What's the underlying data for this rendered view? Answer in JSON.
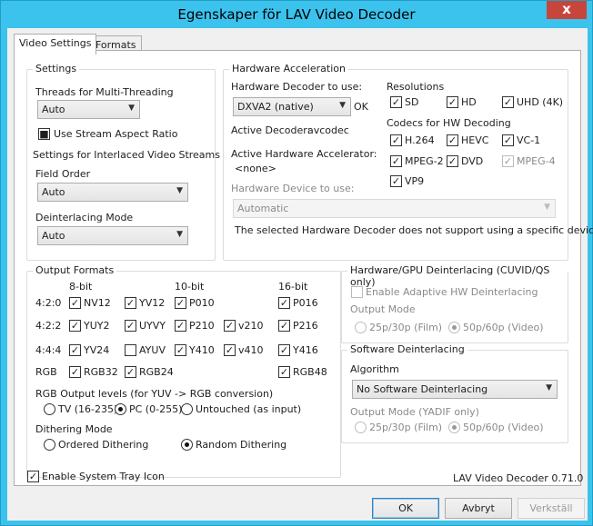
{
  "window": {
    "title": "Egenskaper för LAV Video Decoder",
    "close_glyph": "x"
  },
  "tabs": [
    {
      "label": "Video Settings"
    },
    {
      "label": "Formats"
    }
  ],
  "settings": {
    "title": "Settings",
    "threads_label": "Threads for Multi-Threading",
    "threads_value": "Auto",
    "stream_ar_label": "Use Stream Aspect Ratio",
    "stream_ar_checked": true,
    "interlaced_label": "Settings for Interlaced Video Streams",
    "field_order_label": "Field Order",
    "field_order_value": "Auto",
    "deint_mode_label": "Deinterlacing Mode",
    "deint_mode_value": "Auto"
  },
  "hwaccel": {
    "title": "Hardware Acceleration",
    "decoder_label": "Hardware Decoder to use:",
    "decoder_value": "DXVA2 (native)",
    "decoder_status": "OK",
    "active_decoder_label": "Active Decoder:",
    "active_decoder_value": "avcodec",
    "active_accel_label": "Active Hardware Accelerator:",
    "active_accel_value": "<none>",
    "device_label": "Hardware Device to use:",
    "device_value": "Automatic",
    "note": "The selected Hardware Decoder does not support using a specific device.",
    "resolutions_label": "Resolutions",
    "resolutions": [
      {
        "label": "SD",
        "checked": true
      },
      {
        "label": "HD",
        "checked": true
      },
      {
        "label": "UHD (4K)",
        "checked": true
      }
    ],
    "codecs_label": "Codecs for HW Decoding",
    "codecs": [
      {
        "label": "H.264",
        "checked": true,
        "enabled": true
      },
      {
        "label": "HEVC",
        "checked": true,
        "enabled": true
      },
      {
        "label": "VC-1",
        "checked": true,
        "enabled": true
      },
      {
        "label": "MPEG-2",
        "checked": true,
        "enabled": true
      },
      {
        "label": "DVD",
        "checked": true,
        "enabled": true
      },
      {
        "label": "MPEG-4",
        "checked": true,
        "enabled": false
      },
      {
        "label": "VP9",
        "checked": true,
        "enabled": true
      }
    ]
  },
  "output": {
    "title": "Output Formats",
    "col_headers": [
      "8-bit",
      "10-bit",
      "16-bit"
    ],
    "rows": [
      {
        "label": "4:2:0",
        "items": [
          {
            "label": "NV12",
            "checked": true
          },
          {
            "label": "YV12",
            "checked": true
          },
          {
            "label": "P010",
            "checked": true
          },
          {
            "label": "P016",
            "checked": true
          }
        ]
      },
      {
        "label": "4:2:2",
        "items": [
          {
            "label": "YUY2",
            "checked": true
          },
          {
            "label": "UYVY",
            "checked": true
          },
          {
            "label": "P210",
            "checked": true
          },
          {
            "label": "v210",
            "checked": true
          },
          {
            "label": "P216",
            "checked": true
          }
        ]
      },
      {
        "label": "4:4:4",
        "items": [
          {
            "label": "YV24",
            "checked": true
          },
          {
            "label": "AYUV",
            "checked": false
          },
          {
            "label": "Y410",
            "checked": true
          },
          {
            "label": "v410",
            "checked": true
          },
          {
            "label": "Y416",
            "checked": true
          }
        ]
      },
      {
        "label": "RGB",
        "items": [
          {
            "label": "RGB32",
            "checked": true
          },
          {
            "label": "RGB24",
            "checked": true
          },
          {
            "label": "RGB48",
            "checked": true
          }
        ]
      }
    ],
    "rgb_levels_label": "RGB Output levels (for YUV -> RGB conversion)",
    "rgb_levels": [
      {
        "label": "TV (16-235)",
        "selected": false
      },
      {
        "label": "PC (0-255)",
        "selected": true
      },
      {
        "label": "Untouched (as input)",
        "selected": false
      }
    ],
    "dither_label": "Dithering Mode",
    "dither": [
      {
        "label": "Ordered Dithering",
        "selected": false
      },
      {
        "label": "Random Dithering",
        "selected": true
      }
    ]
  },
  "hwdeint": {
    "title": "Hardware/GPU Deinterlacing (CUVID/QS only)",
    "enable_label": "Enable Adaptive HW Deinterlacing",
    "output_mode_label": "Output Mode",
    "modes": [
      {
        "label": "25p/30p (Film)",
        "selected": false
      },
      {
        "label": "50p/60p (Video)",
        "selected": true
      }
    ]
  },
  "swdeint": {
    "title": "Software Deinterlacing",
    "algorithm_label": "Algorithm",
    "algorithm_value": "No Software Deinterlacing",
    "output_mode_label": "Output Mode (YADIF only)",
    "modes": [
      {
        "label": "25p/30p (Film)",
        "selected": false
      },
      {
        "label": "50p/60p (Video)",
        "selected": true
      }
    ]
  },
  "tray": {
    "label": "Enable System Tray Icon",
    "checked": true
  },
  "version": "LAV Video Decoder 0.71.0",
  "buttons": {
    "ok": "OK",
    "cancel": "Avbryt",
    "apply": "Verkställ"
  },
  "icons": {
    "dropdown": "chevron-down-icon",
    "check": "checkmark-icon",
    "close": "close-icon"
  }
}
